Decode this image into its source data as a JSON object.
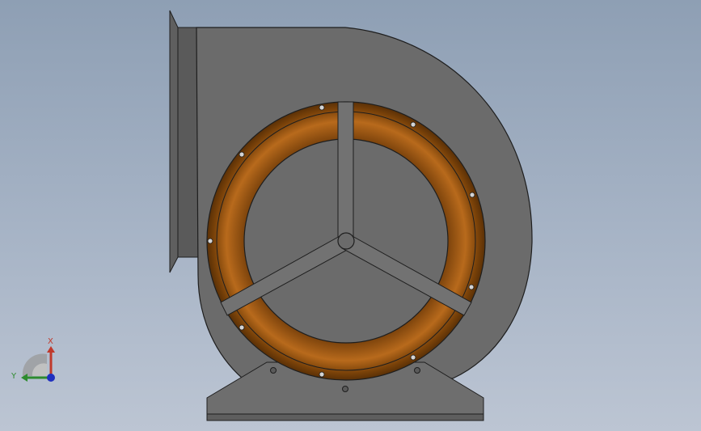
{
  "viewport": {
    "background_top": "#8e9fb4",
    "background_bottom": "#bcc5d3"
  },
  "model": {
    "name": "centrifugal-blower",
    "housing_color": "#6b6b6b",
    "ring_color": "#8a4a0c",
    "ring_highlight": "#c77a2a",
    "edge_color": "#1e1e1e",
    "bolt_color": "#cfcfcf"
  },
  "triad": {
    "x_label": "X",
    "y_label": "Y",
    "x_color": "#c0392b",
    "y_color": "#2e8b2e",
    "z_color": "#1f2fbf"
  }
}
